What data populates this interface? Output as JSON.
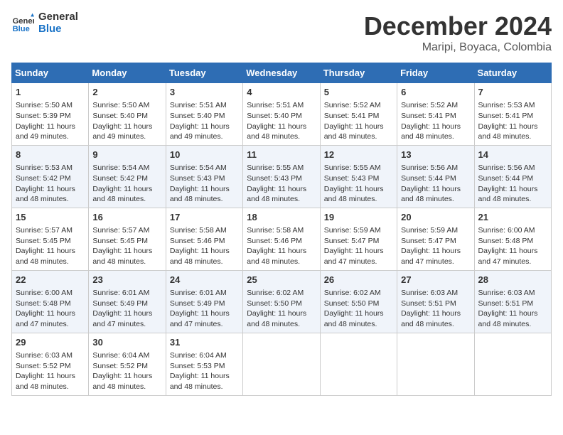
{
  "logo": {
    "text_general": "General",
    "text_blue": "Blue"
  },
  "title": "December 2024",
  "subtitle": "Maripi, Boyaca, Colombia",
  "days_of_week": [
    "Sunday",
    "Monday",
    "Tuesday",
    "Wednesday",
    "Thursday",
    "Friday",
    "Saturday"
  ],
  "weeks": [
    [
      {
        "day": "1",
        "info": "Sunrise: 5:50 AM\nSunset: 5:39 PM\nDaylight: 11 hours\nand 49 minutes."
      },
      {
        "day": "2",
        "info": "Sunrise: 5:50 AM\nSunset: 5:40 PM\nDaylight: 11 hours\nand 49 minutes."
      },
      {
        "day": "3",
        "info": "Sunrise: 5:51 AM\nSunset: 5:40 PM\nDaylight: 11 hours\nand 49 minutes."
      },
      {
        "day": "4",
        "info": "Sunrise: 5:51 AM\nSunset: 5:40 PM\nDaylight: 11 hours\nand 48 minutes."
      },
      {
        "day": "5",
        "info": "Sunrise: 5:52 AM\nSunset: 5:41 PM\nDaylight: 11 hours\nand 48 minutes."
      },
      {
        "day": "6",
        "info": "Sunrise: 5:52 AM\nSunset: 5:41 PM\nDaylight: 11 hours\nand 48 minutes."
      },
      {
        "day": "7",
        "info": "Sunrise: 5:53 AM\nSunset: 5:41 PM\nDaylight: 11 hours\nand 48 minutes."
      }
    ],
    [
      {
        "day": "8",
        "info": "Sunrise: 5:53 AM\nSunset: 5:42 PM\nDaylight: 11 hours\nand 48 minutes."
      },
      {
        "day": "9",
        "info": "Sunrise: 5:54 AM\nSunset: 5:42 PM\nDaylight: 11 hours\nand 48 minutes."
      },
      {
        "day": "10",
        "info": "Sunrise: 5:54 AM\nSunset: 5:43 PM\nDaylight: 11 hours\nand 48 minutes."
      },
      {
        "day": "11",
        "info": "Sunrise: 5:55 AM\nSunset: 5:43 PM\nDaylight: 11 hours\nand 48 minutes."
      },
      {
        "day": "12",
        "info": "Sunrise: 5:55 AM\nSunset: 5:43 PM\nDaylight: 11 hours\nand 48 minutes."
      },
      {
        "day": "13",
        "info": "Sunrise: 5:56 AM\nSunset: 5:44 PM\nDaylight: 11 hours\nand 48 minutes."
      },
      {
        "day": "14",
        "info": "Sunrise: 5:56 AM\nSunset: 5:44 PM\nDaylight: 11 hours\nand 48 minutes."
      }
    ],
    [
      {
        "day": "15",
        "info": "Sunrise: 5:57 AM\nSunset: 5:45 PM\nDaylight: 11 hours\nand 48 minutes."
      },
      {
        "day": "16",
        "info": "Sunrise: 5:57 AM\nSunset: 5:45 PM\nDaylight: 11 hours\nand 48 minutes."
      },
      {
        "day": "17",
        "info": "Sunrise: 5:58 AM\nSunset: 5:46 PM\nDaylight: 11 hours\nand 48 minutes."
      },
      {
        "day": "18",
        "info": "Sunrise: 5:58 AM\nSunset: 5:46 PM\nDaylight: 11 hours\nand 48 minutes."
      },
      {
        "day": "19",
        "info": "Sunrise: 5:59 AM\nSunset: 5:47 PM\nDaylight: 11 hours\nand 47 minutes."
      },
      {
        "day": "20",
        "info": "Sunrise: 5:59 AM\nSunset: 5:47 PM\nDaylight: 11 hours\nand 47 minutes."
      },
      {
        "day": "21",
        "info": "Sunrise: 6:00 AM\nSunset: 5:48 PM\nDaylight: 11 hours\nand 47 minutes."
      }
    ],
    [
      {
        "day": "22",
        "info": "Sunrise: 6:00 AM\nSunset: 5:48 PM\nDaylight: 11 hours\nand 47 minutes."
      },
      {
        "day": "23",
        "info": "Sunrise: 6:01 AM\nSunset: 5:49 PM\nDaylight: 11 hours\nand 47 minutes."
      },
      {
        "day": "24",
        "info": "Sunrise: 6:01 AM\nSunset: 5:49 PM\nDaylight: 11 hours\nand 47 minutes."
      },
      {
        "day": "25",
        "info": "Sunrise: 6:02 AM\nSunset: 5:50 PM\nDaylight: 11 hours\nand 48 minutes."
      },
      {
        "day": "26",
        "info": "Sunrise: 6:02 AM\nSunset: 5:50 PM\nDaylight: 11 hours\nand 48 minutes."
      },
      {
        "day": "27",
        "info": "Sunrise: 6:03 AM\nSunset: 5:51 PM\nDaylight: 11 hours\nand 48 minutes."
      },
      {
        "day": "28",
        "info": "Sunrise: 6:03 AM\nSunset: 5:51 PM\nDaylight: 11 hours\nand 48 minutes."
      }
    ],
    [
      {
        "day": "29",
        "info": "Sunrise: 6:03 AM\nSunset: 5:52 PM\nDaylight: 11 hours\nand 48 minutes."
      },
      {
        "day": "30",
        "info": "Sunrise: 6:04 AM\nSunset: 5:52 PM\nDaylight: 11 hours\nand 48 minutes."
      },
      {
        "day": "31",
        "info": "Sunrise: 6:04 AM\nSunset: 5:53 PM\nDaylight: 11 hours\nand 48 minutes."
      },
      null,
      null,
      null,
      null
    ]
  ]
}
